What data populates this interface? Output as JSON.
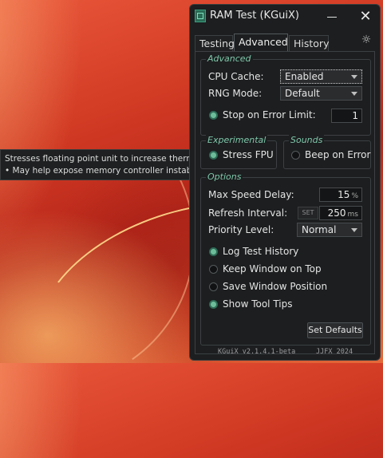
{
  "tooltip": {
    "line1": "Stresses floating point unit to increase thermals.",
    "line2": "• May help expose memory controller instability."
  },
  "window": {
    "title": "RAM Test (KGuiX)",
    "close_glyph": "✕",
    "settings_glyph": "☼"
  },
  "tabs": [
    {
      "label": "Testing",
      "active": false
    },
    {
      "label": "Advanced",
      "active": true
    },
    {
      "label": "History",
      "active": false
    }
  ],
  "advanced": {
    "title": "Advanced",
    "cpu_cache_label": "CPU Cache:",
    "cpu_cache_value": "Enabled",
    "rng_mode_label": "RNG Mode:",
    "rng_mode_value": "Default",
    "stop_on_error_label": "Stop on Error Limit:",
    "stop_on_error_checked": true,
    "error_limit_value": "1"
  },
  "experimental": {
    "title": "Experimental",
    "stress_fpu_label": "Stress FPU",
    "stress_fpu_checked": true
  },
  "sounds": {
    "title": "Sounds",
    "beep_on_error_label": "Beep on Error",
    "beep_on_error_checked": false
  },
  "options": {
    "title": "Options",
    "max_speed_delay_label": "Max Speed Delay:",
    "max_speed_delay_value": "15",
    "max_speed_delay_unit": "%",
    "refresh_interval_label": "Refresh Interval:",
    "refresh_set_label": "SET",
    "refresh_interval_value": "250",
    "refresh_interval_unit": "ms",
    "priority_level_label": "Priority Level:",
    "priority_level_value": "Normal",
    "log_test_history_label": "Log Test History",
    "log_test_history_checked": true,
    "keep_on_top_label": "Keep Window on Top",
    "keep_on_top_checked": false,
    "save_position_label": "Save Window Position",
    "save_position_checked": false,
    "show_tooltips_label": "Show Tool Tips",
    "show_tooltips_checked": true,
    "set_defaults_label": "Set Defaults"
  },
  "footer": {
    "version": "KGuiX v2.1.4.1-beta",
    "credit": "JJFX 2024"
  },
  "colors": {
    "accent_green": "#6dbd9a",
    "group_title": "#7fc7ab",
    "window_bg": "#1c1e1f"
  }
}
